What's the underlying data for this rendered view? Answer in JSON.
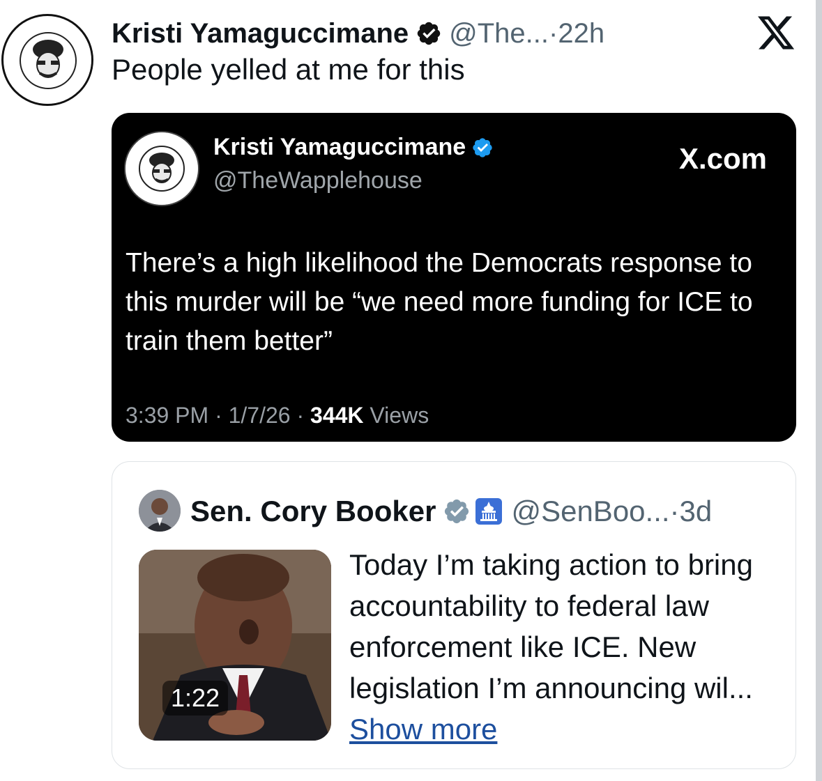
{
  "tweet": {
    "author_name": "Kristi Yamaguccimane",
    "handle_short": "@The...",
    "separator": "·",
    "time_ago": "22h",
    "text": "People yelled at me for this",
    "avatar_label": "profile-avatar"
  },
  "embedded_card": {
    "author_name": "Kristi Yamaguccimane",
    "handle": "@TheWapplehouse",
    "brand": "X.com",
    "body": "There’s a high likelihood the Democrats response to this murder will be “we need more funding for ICE to train them better”",
    "time": "3:39 PM · 1/7/26 · ",
    "views_count": "344K",
    "views_label": " Views"
  },
  "quoted_post": {
    "author_name": "Sen. Cory Booker",
    "handle_short": "@SenBoo...",
    "separator": "·",
    "time_ago": "3d",
    "text": "Today I’m taking action to bring accountability to federal law enforcement like ICE. New legislation I’m announcing wil...",
    "show_more": "Show more",
    "video_duration": "1:22"
  },
  "colors": {
    "verified_blue": "#1d9bf0",
    "verified_grey": "#829aab",
    "link_blue": "#1d4f9e",
    "dark_card_bg": "#000000"
  },
  "icons": [
    "verified-badge-icon",
    "x-logo-icon",
    "government-building-icon",
    "grey-verified-badge-icon"
  ]
}
